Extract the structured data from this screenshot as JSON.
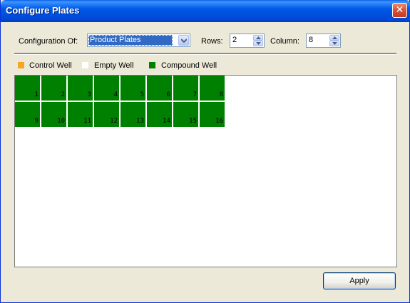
{
  "window": {
    "title": "Configure Plates",
    "close_glyph": "✕"
  },
  "config": {
    "config_of_label": "Configuration Of:",
    "config_of_value": "Product Plates",
    "rows_label": "Rows:",
    "rows_value": "2",
    "column_label": "Column:",
    "column_value": "8"
  },
  "legend": [
    {
      "label": "Control Well",
      "color": "#f5a623"
    },
    {
      "label": "Empty Well",
      "color": "#ffffff"
    },
    {
      "label": "Compound Well",
      "color": "#008000"
    }
  ],
  "plate": {
    "rows": 2,
    "columns": 8,
    "well_color": "#008000",
    "wells": [
      "1",
      "2",
      "3",
      "4",
      "5",
      "6",
      "7",
      "8",
      "9",
      "10",
      "11",
      "12",
      "13",
      "14",
      "15",
      "16"
    ]
  },
  "actions": {
    "apply_label": "Apply"
  }
}
